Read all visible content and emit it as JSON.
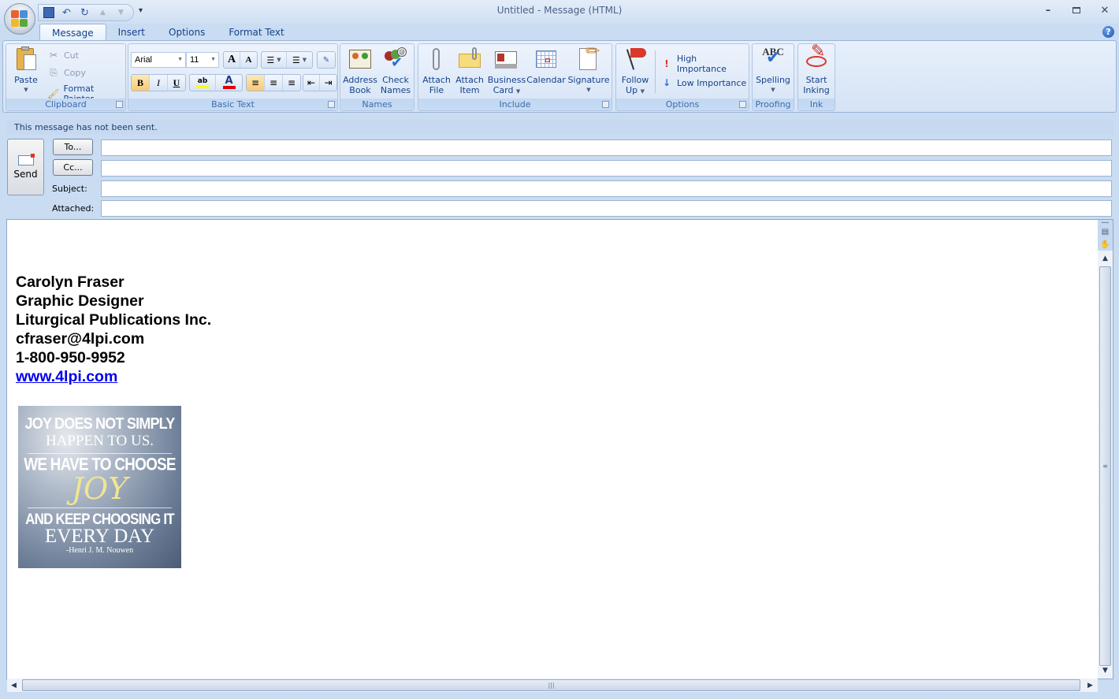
{
  "window": {
    "title": "Untitled - Message (HTML)",
    "minimize_icon": "minimize-icon",
    "maximize_icon": "maximize-icon",
    "close_icon": "close-icon",
    "help_label": "?"
  },
  "qat": {
    "items": [
      {
        "name": "save",
        "icon": "save-icon",
        "glyph": "💾"
      },
      {
        "name": "undo",
        "icon": "undo-icon",
        "glyph": "↶"
      },
      {
        "name": "redo",
        "icon": "redo-icon",
        "glyph": "↻"
      },
      {
        "name": "previous-item",
        "icon": "up-arrow-icon",
        "glyph": "▲"
      },
      {
        "name": "next-item",
        "icon": "down-arrow-icon",
        "glyph": "▼"
      }
    ],
    "more": "▾"
  },
  "tabs": [
    "Message",
    "Insert",
    "Options",
    "Format Text"
  ],
  "ribbon": {
    "clipboard": {
      "label": "Clipboard",
      "paste": "Paste",
      "cut": "Cut",
      "copy": "Copy",
      "format_painter": "Format Painter"
    },
    "basic_text": {
      "label": "Basic Text",
      "font": "Arial",
      "size": "11",
      "grow": "A",
      "shrink": "A",
      "bold": "B",
      "italic": "I",
      "underline": "U",
      "highlight_color": "#ffff00",
      "font_color": "#e0000a"
    },
    "names": {
      "label": "Names",
      "address_book": [
        "Address",
        "Book"
      ],
      "check_names": [
        "Check",
        "Names"
      ]
    },
    "include": {
      "label": "Include",
      "attach_file": [
        "Attach",
        "File"
      ],
      "attach_item": [
        "Attach",
        "Item"
      ],
      "business_card": [
        "Business",
        "Card"
      ],
      "calendar": "Calendar",
      "signature": "Signature"
    },
    "options": {
      "label": "Options",
      "follow_up": [
        "Follow",
        "Up"
      ],
      "high_importance": "High Importance",
      "low_importance": "Low Importance"
    },
    "proofing": {
      "label": "Proofing",
      "spelling": "Spelling",
      "abc": "ABC"
    },
    "ink": {
      "label": "Ink",
      "start_inking": [
        "Start",
        "Inking"
      ]
    }
  },
  "infobar": "This message has not been sent.",
  "header": {
    "send": "Send",
    "to_button": "To...",
    "cc_button": "Cc...",
    "subject_label": "Subject:",
    "attached_label": "Attached:",
    "to_value": "",
    "cc_value": "",
    "subject_value": "",
    "attached_value": ""
  },
  "body": {
    "signature": {
      "name": "Carolyn Fraser",
      "title": "Graphic Designer",
      "company": "Liturgical Publications Inc.",
      "email": "cfraser@4lpi.com",
      "phone": "1-800-950-9952",
      "website": "www.4lpi.com"
    },
    "quote_image": {
      "line1": "JOY DOES NOT SIMPLY",
      "line2": "HAPPEN TO US.",
      "line3": "WE HAVE TO CHOOSE",
      "line4": "JOY",
      "line5": "AND KEEP CHOOSING IT",
      "line6": "EVERY DAY",
      "attribution": "-Henri J. M. Nouwen"
    }
  }
}
